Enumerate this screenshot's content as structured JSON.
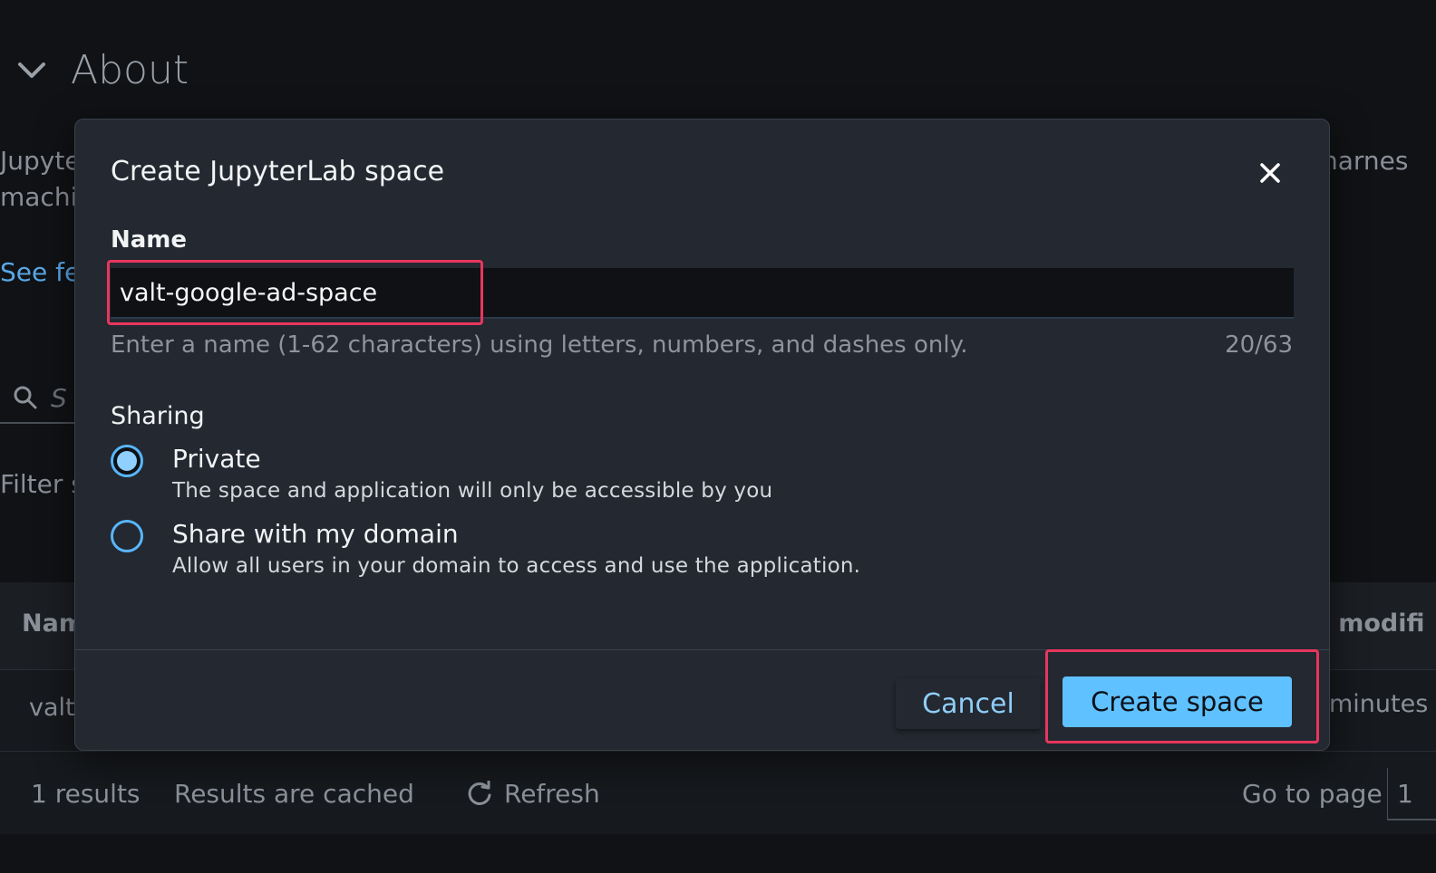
{
  "background": {
    "about_title": "About",
    "desc_left_line1": "Jupyte",
    "desc_left_line2": "machi",
    "desc_right": "harnes",
    "see_link": "See fe",
    "search_placeholder": "S",
    "filter_label": "Filter s",
    "table": {
      "col_name": "Nam",
      "col_modified": ": modifi",
      "row_name": "valt",
      "row_modified": "minutes"
    },
    "footer": {
      "results": "1 results",
      "cached": "Results are cached",
      "refresh": "Refresh",
      "goto": "Go to page",
      "page": "1"
    }
  },
  "modal": {
    "title": "Create JupyterLab space",
    "name_label": "Name",
    "name_value": "valt-google-ad-space",
    "name_hint": "Enter a name (1-62 characters) using letters, numbers, and dashes only.",
    "name_counter": "20/63",
    "sharing_label": "Sharing",
    "options": [
      {
        "label": "Private",
        "description": "The space and application will only be accessible by you",
        "checked": true
      },
      {
        "label": "Share with my domain",
        "description": "Allow all users in your domain to access and use the application.",
        "checked": false
      }
    ],
    "cancel_label": "Cancel",
    "create_label": "Create space"
  },
  "colors": {
    "accent": "#5fc1ff",
    "highlight": "#e8365d",
    "modal_bg": "#232831",
    "page_bg": "#101215"
  }
}
